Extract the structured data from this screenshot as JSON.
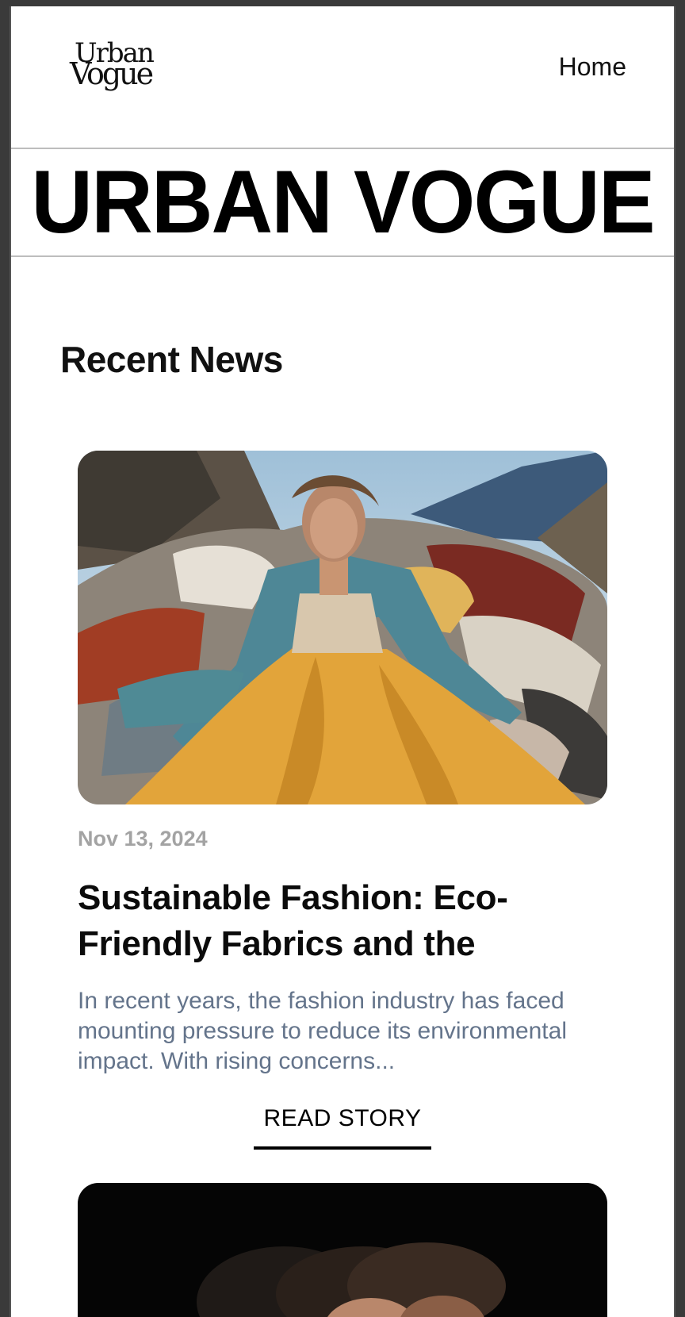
{
  "header": {
    "logo_line1": "Urban",
    "logo_line2": "Vogue",
    "nav_home": "Home"
  },
  "masthead": {
    "title": "URBAN VOGUE"
  },
  "section": {
    "title": "Recent News"
  },
  "articles": [
    {
      "date": "Nov 13, 2024",
      "title": "Sustainable Fashion: Eco-Friendly Fabrics and the",
      "excerpt": "In recent years, the fashion industry has faced mounting pressure to reduce its environmental impact. With rising concerns...",
      "cta": "READ STORY"
    }
  ]
}
